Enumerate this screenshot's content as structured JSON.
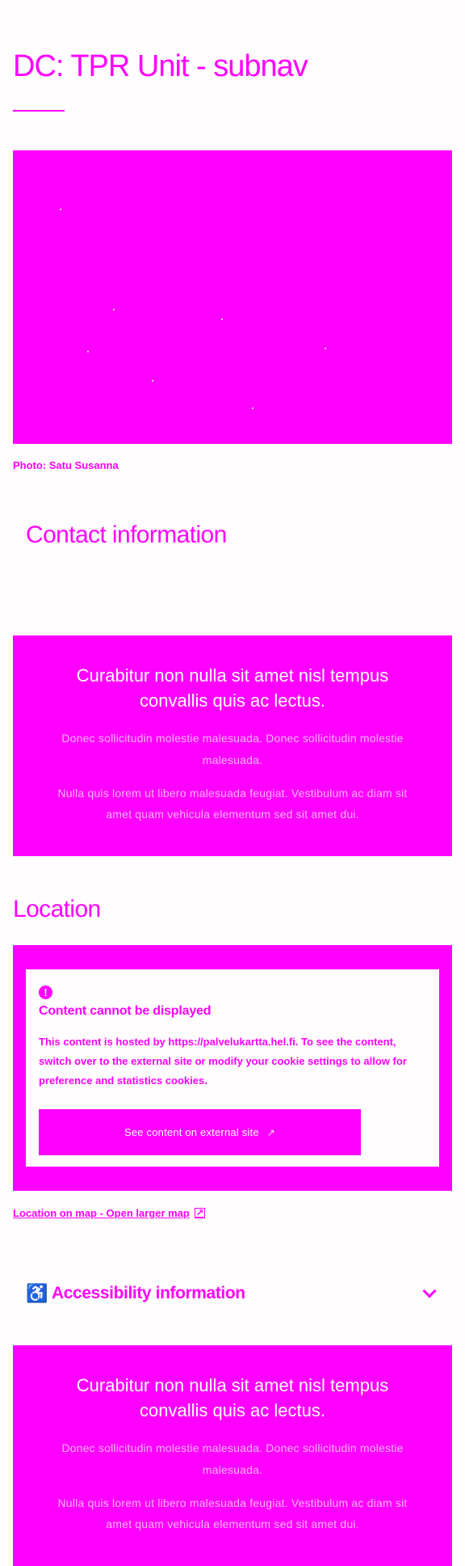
{
  "page": {
    "title": "DC: TPR Unit - subnav",
    "photo_credit": "Photo: Satu Susanna"
  },
  "contact": {
    "heading": "Contact information",
    "lead": "Curabitur non nulla sit amet nisl tempus convallis quis ac lectus.",
    "body1": "Donec sollicitudin molestie malesuada. Donec sollicitudin molestie malesuada.",
    "body2": "Nulla quis lorem ut libero malesuada feugiat. Vestibulum ac diam sit amet quam vehicula elementum sed sit amet dui."
  },
  "location": {
    "heading": "Location",
    "notice_title": "Content cannot be displayed",
    "notice_text": "This content is hosted by https://palvelukartta.hel.fi. To see the content, switch over to the external site or modify your cookie settings to allow for preference and statistics cookies.",
    "button_label": "See content on external site",
    "map_link_label": "Location on map - Open larger map"
  },
  "accessibility": {
    "label": "Accessibility information",
    "lead": "Curabitur non nulla sit amet nisl tempus convallis quis ac lectus.",
    "body1": "Donec sollicitudin molestie malesuada. Donec sollicitudin molestie malesuada.",
    "body2": "Nulla quis lorem ut libero malesuada feugiat. Vestibulum ac diam sit amet quam vehicula elementum sed sit amet dui."
  },
  "icons": {
    "alert": "alert-circle-icon",
    "external": "external-link-icon",
    "accessibility": "wheelchair-icon",
    "chevron": "chevron-down-icon"
  },
  "colors": {
    "accent": "#ff00ff",
    "background": "#fffdfd"
  }
}
